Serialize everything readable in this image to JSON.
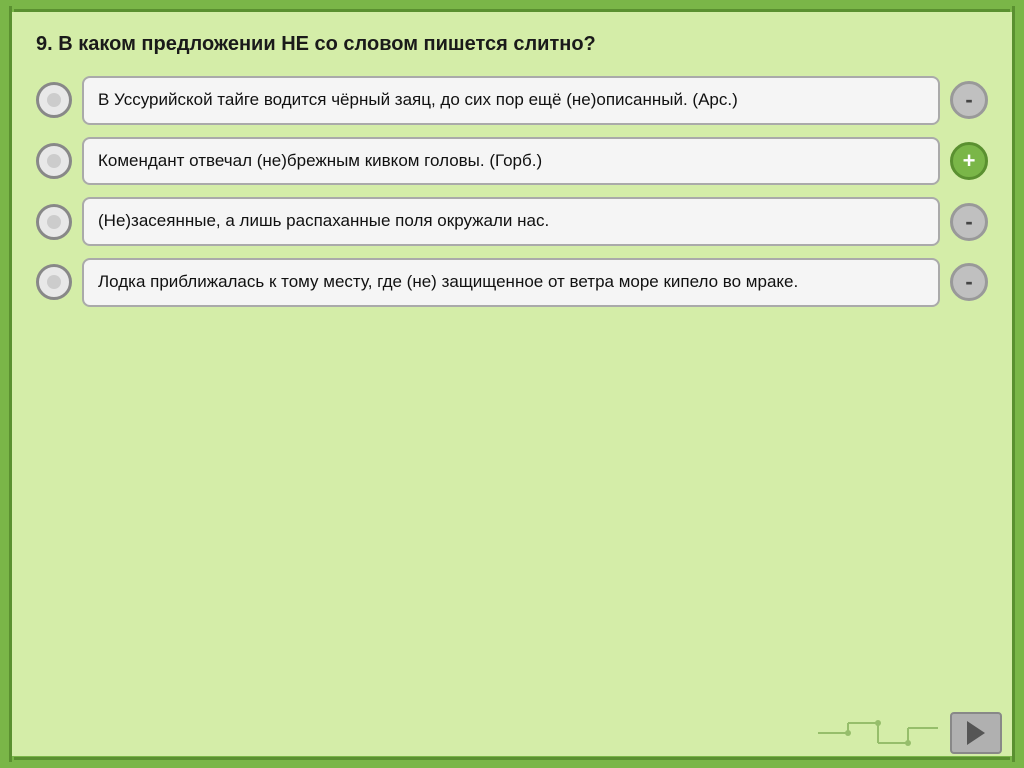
{
  "question": {
    "number": "9.",
    "text": "9.  В  каком  предложении  НЕ  со  словом  пишется  слитно?"
  },
  "answers": [
    {
      "id": 1,
      "text": "В Уссурийской тайге водится чёрный заяц, до сих пор ещё (не)описанный. (Арс.)",
      "sign": "-",
      "sign_type": "minus"
    },
    {
      "id": 2,
      "text": "Комендант отвечал (не)брежным кивком головы. (Горб.)",
      "sign": "+",
      "sign_type": "plus"
    },
    {
      "id": 3,
      "text": "(Не)засеянные,  а  лишь  распаханные  поля окружали нас.",
      "sign": "-",
      "sign_type": "minus"
    },
    {
      "id": 4,
      "text": "Лодка  приближалась  к  тому  месту,  где  (не) защищенное от ветра море кипело во мраке.",
      "sign": "-",
      "sign_type": "minus"
    }
  ],
  "navigation": {
    "next_label": "▶"
  }
}
